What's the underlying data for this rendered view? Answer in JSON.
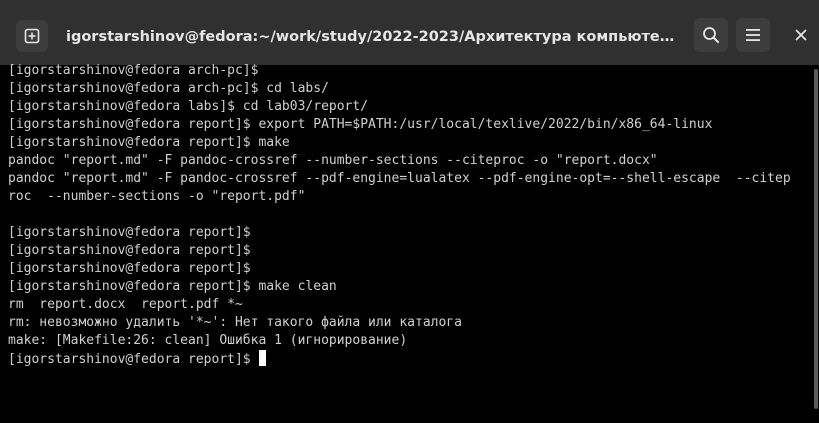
{
  "window": {
    "title": "igorstarshinov@fedora:~/work/study/2022-2023/Архитектура компьютера/arch-pc/labs/lab03/report",
    "icons": {
      "new_tab": "plus-in-square-icon",
      "search": "search-icon",
      "menu": "hamburger-menu-icon",
      "close": "close-icon"
    }
  },
  "terminal": {
    "lines": [
      "[igorstarshinov@fedora arch-pc]$",
      "[igorstarshinov@fedora arch-pc]$ cd labs/",
      "[igorstarshinov@fedora labs]$ cd lab03/report/",
      "[igorstarshinov@fedora report]$ export PATH=$PATH:/usr/local/texlive/2022/bin/x86_64-linux",
      "[igorstarshinov@fedora report]$ make",
      "pandoc \"report.md\" -F pandoc-crossref --number-sections --citeproc -o \"report.docx\"",
      "pandoc \"report.md\" -F pandoc-crossref --pdf-engine=lualatex --pdf-engine-opt=--shell-escape  --citep",
      "roc  --number-sections -o \"report.pdf\"",
      "",
      "[igorstarshinov@fedora report]$",
      "[igorstarshinov@fedora report]$",
      "[igorstarshinov@fedora report]$",
      "[igorstarshinov@fedora report]$ make clean",
      "rm  report.docx  report.pdf *~",
      "rm: невозможно удалить '*~': Нет такого файла или каталога",
      "make: [Makefile:26: clean] Ошибка 1 (игнорирование)"
    ],
    "prompt": "[igorstarshinov@fedora report]$ ",
    "colors": {
      "background": "#000000",
      "foreground": "#d0d0d0",
      "titlebar": "#303030"
    }
  }
}
